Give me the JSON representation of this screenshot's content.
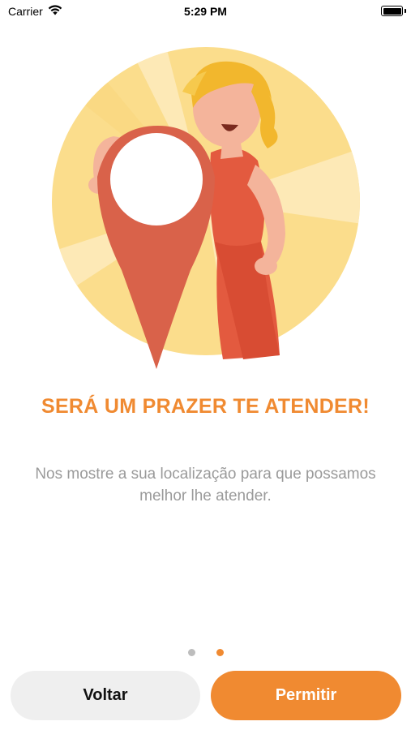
{
  "status_bar": {
    "carrier": "Carrier",
    "time": "5:29 PM",
    "wifi_icon": "wifi-icon",
    "battery_icon": "battery-icon"
  },
  "onboarding": {
    "illustration": "woman-holding-location-pin-illustration",
    "title": "SERÁ UM PRAZER TE ATENDER!",
    "description": "Nos mostre a sua localização para que possamos melhor lhe atender.",
    "page_indicator": {
      "total": 2,
      "current": 2
    }
  },
  "actions": {
    "back_label": "Voltar",
    "allow_label": "Permitir"
  },
  "colors": {
    "accent": "#F08A31",
    "pin": "#D9624A",
    "circle_bg": "#FBDD8C",
    "muted_text": "#9A9A9A",
    "dot_inactive": "#BDBDBD",
    "back_button_bg": "#EFEFEF"
  }
}
